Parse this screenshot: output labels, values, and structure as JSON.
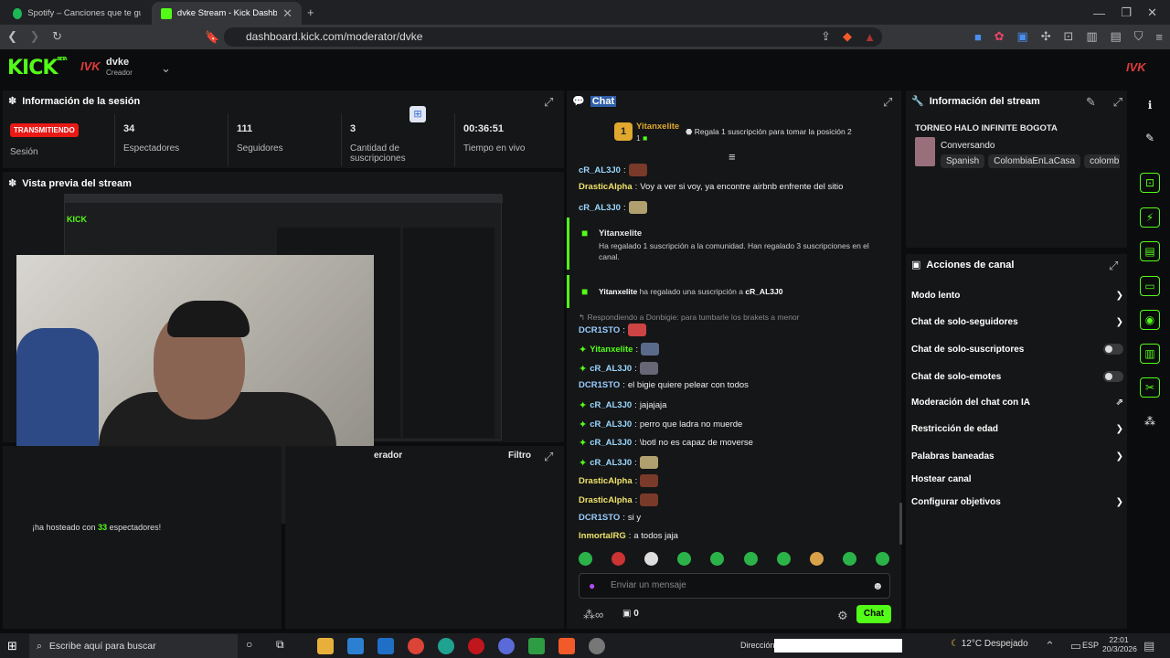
{
  "browser": {
    "tabs": [
      {
        "label": "Spotify – Canciones que te gustan",
        "icon": "spotify-icon"
      },
      {
        "label": "dvke Stream - Kick Dashboard",
        "icon": "kick-icon"
      }
    ],
    "url": "dashboard.kick.com/moderator/dvke"
  },
  "header": {
    "logo": "KICK",
    "logo_beta": "BETA",
    "avatar": "IVK",
    "username": "dvke",
    "role": "Creador"
  },
  "session": {
    "title": "Información de la sesión",
    "status": "TRANSMITIENDO",
    "status_label": "Sesión",
    "stats": [
      {
        "value": "34",
        "label": "Espectadores"
      },
      {
        "value": "111",
        "label": "Seguidores"
      },
      {
        "value": "3",
        "label": "Cantidad de suscripciones"
      },
      {
        "value": "00:36:51",
        "label": "Tiempo en vivo"
      }
    ]
  },
  "preview": {
    "title": "Vista previa del stream"
  },
  "bottom_left": {
    "host_text_pre": "¡ha hosteado con ",
    "host_count": "33",
    "host_text_post": " espectadores!",
    "panel_title": "erador",
    "filter": "Filtro"
  },
  "chat": {
    "title": "Chat",
    "pinned": {
      "rank": "1",
      "user": "Yitanxelite",
      "count": "1",
      "text": "Regala 1 suscripción para tomar la posición 2"
    },
    "messages": [
      {
        "user": "cR_AL3J0",
        "text": ""
      },
      {
        "user": "DrasticAlpha",
        "text": "Voy a ver si voy, ya encontre airbnb enfrente del sitio"
      },
      {
        "user": "cR_AL3J0",
        "text": ""
      }
    ],
    "gift1": {
      "user": "Yitanxelite",
      "text": "Ha regalado 1 suscripción a la comunidad. Han regalado 3 suscripciones en el canal."
    },
    "gift2": {
      "user": "Yitanxelite",
      "mid": " ha regalado una suscripción a ",
      "to": "cR_AL3J0"
    },
    "reply": "Respondiendo a Donbigie: para tumbarle los brakets a menor",
    "messages2": [
      {
        "user": "DCR1STO",
        "text": ""
      },
      {
        "user": "Yitanxelite",
        "text": ""
      },
      {
        "user": "cR_AL3J0",
        "text": ""
      },
      {
        "user": "DCR1STO",
        "text": "el bigie quiere pelear con todos"
      },
      {
        "user": "cR_AL3J0",
        "text": "jajajaja"
      },
      {
        "user": "cR_AL3J0",
        "text": "perro que ladra no muerde"
      },
      {
        "user": "cR_AL3J0",
        "text": "\\botl no es capaz de moverse"
      },
      {
        "user": "cR_AL3J0",
        "text": ""
      },
      {
        "user": "DrasticAlpha",
        "text": ""
      },
      {
        "user": "DrasticAlpha",
        "text": ""
      },
      {
        "user": "DCR1STO",
        "text": "si y"
      },
      {
        "user": "InmortalRG",
        "text": "a todos jaja"
      }
    ],
    "placeholder": "Enviar un mensaje",
    "counter": "0",
    "send": "Chat"
  },
  "stream_info": {
    "title": "Información del stream",
    "stream_title": "TORNEO HALO INFINITE BOGOTA",
    "category": "Conversando",
    "tags": [
      "Spanish",
      "ColombiaEnLaCasa",
      "colombi"
    ]
  },
  "actions": {
    "title": "Acciones de canal",
    "items": [
      {
        "label": "Modo lento",
        "kind": "arrow"
      },
      {
        "label": "Chat de solo-seguidores",
        "kind": "arrow"
      },
      {
        "label": "Chat de solo-suscriptores",
        "kind": "toggle"
      },
      {
        "label": "Chat de solo-emotes",
        "kind": "toggle"
      },
      {
        "label": "Moderación del chat con IA",
        "kind": "link"
      },
      {
        "label": "Restricción de edad",
        "kind": "arrow"
      },
      {
        "label": "Palabras baneadas",
        "kind": "arrow"
      },
      {
        "label": "Hostear canal",
        "kind": "none"
      },
      {
        "label": "Configurar objetivos",
        "kind": "arrow"
      }
    ]
  },
  "taskbar": {
    "search": "Escribe aquí para buscar",
    "address": "Dirección",
    "weather": "12°C Despejado",
    "lang": "ESP",
    "time": "22:01",
    "date": "20/3/2026"
  },
  "colors": {
    "accent": "#53fc18",
    "live": "#e91916"
  }
}
